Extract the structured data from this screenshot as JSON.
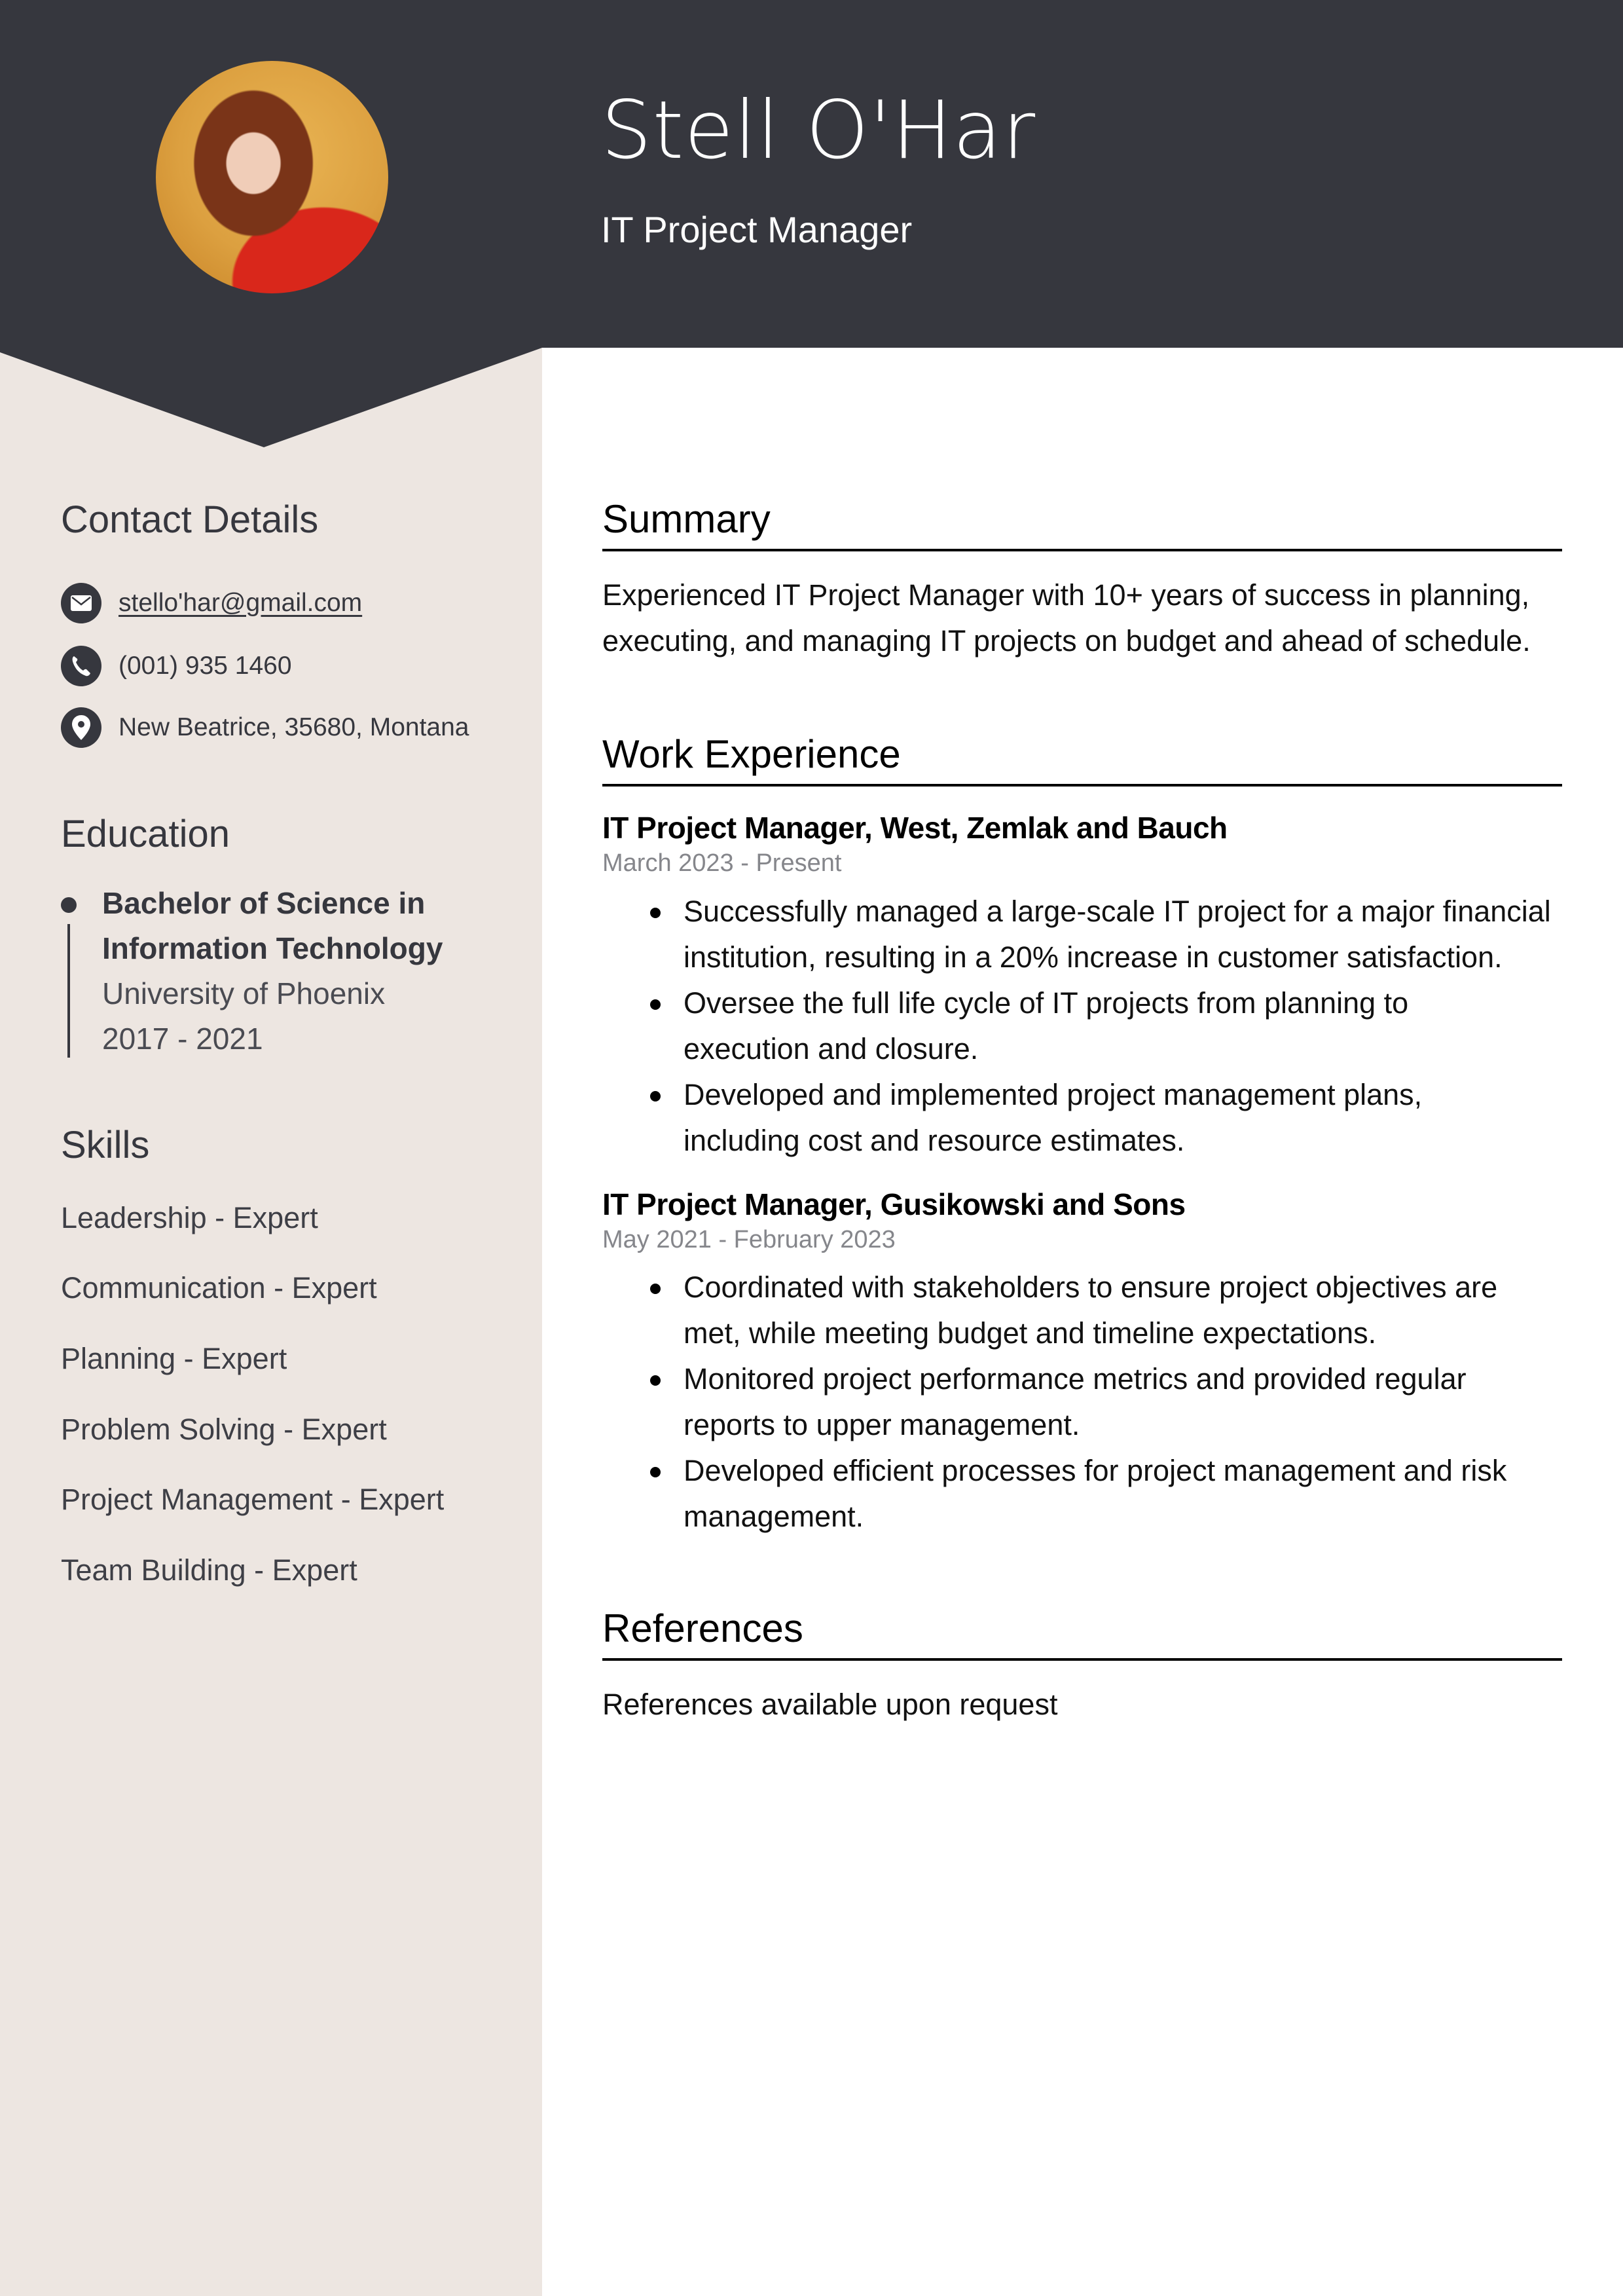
{
  "header": {
    "name": "Stell O'Har",
    "job_title": "IT Project Manager",
    "photo_alt": "profile-photo"
  },
  "colors": {
    "header_bg": "#36373e",
    "sidebar_bg": "#ede6e1",
    "main_bg": "#ffffff",
    "muted_text": "#85868b"
  },
  "sidebar": {
    "contact": {
      "heading": "Contact Details",
      "items": [
        {
          "icon": "envelope-icon",
          "text": "stello'har@gmail.com"
        },
        {
          "icon": "phone-icon",
          "text": "(001) 935 1460"
        },
        {
          "icon": "map-pin-icon",
          "text": "New Beatrice, 35680, Montana"
        }
      ]
    },
    "education": {
      "heading": "Education",
      "items": [
        {
          "degree_line1": "Bachelor of Science in",
          "degree_line2": "Information Technology",
          "school": "University of Phoenix",
          "years": "2017 - 2021"
        }
      ]
    },
    "skills": {
      "heading": "Skills",
      "items": [
        "Leadership - Expert",
        "Communication - Expert",
        "Planning - Expert",
        "Problem Solving - Expert",
        "Project Management - Expert",
        "Team Building - Expert"
      ]
    }
  },
  "main": {
    "summary": {
      "heading": "Summary",
      "lines": [
        "Experienced IT Project Manager with 10+ years of success in planning,",
        "executing, and managing IT projects on budget and ahead of schedule."
      ]
    },
    "experience": {
      "heading": "Work Experience",
      "jobs": [
        {
          "title": "IT Project Manager, West, Zemlak and Bauch",
          "dates": "March 2023 - Present",
          "bullets": [
            [
              "Successfully managed a large-scale IT project for a major financial",
              "institution, resulting in a 20% increase in customer satisfaction."
            ],
            [
              "Oversee the full life cycle of IT projects from planning to",
              "execution and closure."
            ],
            [
              "Developed and implemented project management plans,",
              "including cost and resource estimates."
            ]
          ]
        },
        {
          "title": "IT Project Manager, Gusikowski and Sons",
          "dates": "May 2021 - February 2023",
          "bullets": [
            [
              "Coordinated with stakeholders to ensure project objectives are",
              "met, while meeting budget and timeline expectations."
            ],
            [
              "Monitored project performance metrics and provided regular",
              "reports to upper management."
            ],
            [
              "Developed efficient processes for project management and risk",
              "management."
            ]
          ]
        }
      ]
    },
    "references": {
      "heading": "References",
      "text": "References available upon request"
    }
  }
}
